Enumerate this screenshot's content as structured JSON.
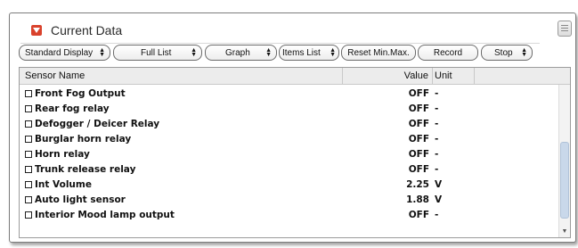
{
  "panel": {
    "title": "Current Data"
  },
  "toolbar": {
    "standard_display": "Standard Display",
    "full_list": "Full List",
    "graph": "Graph",
    "items_list": "Items List",
    "reset_minmax": "Reset Min.Max.",
    "record": "Record",
    "stop": "Stop"
  },
  "table": {
    "columns": {
      "name": "Sensor Name",
      "value": "Value",
      "unit": "Unit"
    },
    "rows": [
      {
        "name": "Front Fog Output",
        "value": "OFF",
        "unit": "-"
      },
      {
        "name": "Rear fog relay",
        "value": "OFF",
        "unit": "-"
      },
      {
        "name": "Defogger / Deicer Relay",
        "value": "OFF",
        "unit": "-"
      },
      {
        "name": "Burglar horn relay",
        "value": "OFF",
        "unit": "-"
      },
      {
        "name": "Horn relay",
        "value": "OFF",
        "unit": "-"
      },
      {
        "name": "Trunk release relay",
        "value": "OFF",
        "unit": "-"
      },
      {
        "name": "Int Volume",
        "value": "2.25",
        "unit": "V"
      },
      {
        "name": "Auto light sensor",
        "value": "1.88",
        "unit": "V"
      },
      {
        "name": "Interior Mood lamp output",
        "value": "OFF",
        "unit": "-"
      }
    ]
  },
  "colors": {
    "title_icon": "#d9422c",
    "scroll_thumb": "#c9d8ea"
  },
  "icons": {
    "title": "collapse-icon",
    "corner": "menu-icon",
    "checkbox": "checkbox-icon",
    "dropdown": "updown-arrow-icon"
  }
}
